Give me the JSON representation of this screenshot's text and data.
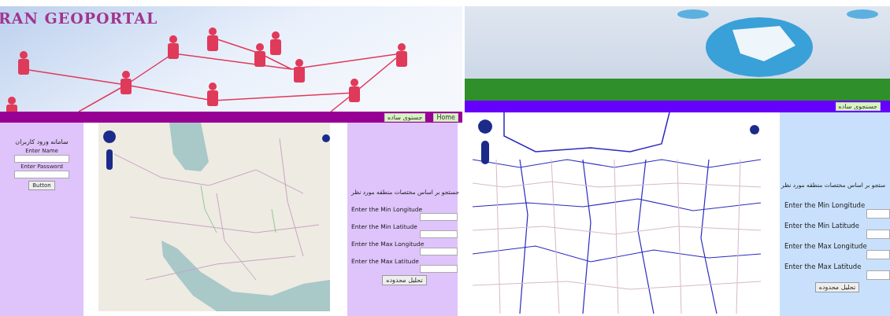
{
  "left_page": {
    "banner": {
      "title": "RAN GEOPORTAL"
    },
    "nav": {
      "buttons": [
        "Home",
        "جستوی ساده"
      ]
    },
    "login": {
      "heading": "سامانه ورود کاربران",
      "fields": [
        {
          "label": "Enter Name"
        },
        {
          "label": "Enter Password"
        }
      ],
      "button": "Button"
    },
    "search": {
      "heading": "جستجو بر اساس مختصات منطقه مورد نظر",
      "fields": [
        {
          "label": "Enter the Min Longitude"
        },
        {
          "label": "Enter the Min Latitude"
        },
        {
          "label": "Enter the Max Longitude"
        },
        {
          "label": "Enter the Max Latitude"
        }
      ],
      "button": "تحلیل محدوده"
    }
  },
  "right_page": {
    "nav": {
      "buttons": [
        "جستجوی ساده"
      ]
    },
    "search": {
      "heading": "ستجو بر اساس مختصات منطقه مورد نظر",
      "fields": [
        {
          "label": "Enter the Min Longitude"
        },
        {
          "label": "Enter the Min Latitude"
        },
        {
          "label": "Enter the Max Longitude"
        },
        {
          "label": "Enter the Max Latitude"
        }
      ],
      "button": "تحلیل محدوده"
    }
  }
}
